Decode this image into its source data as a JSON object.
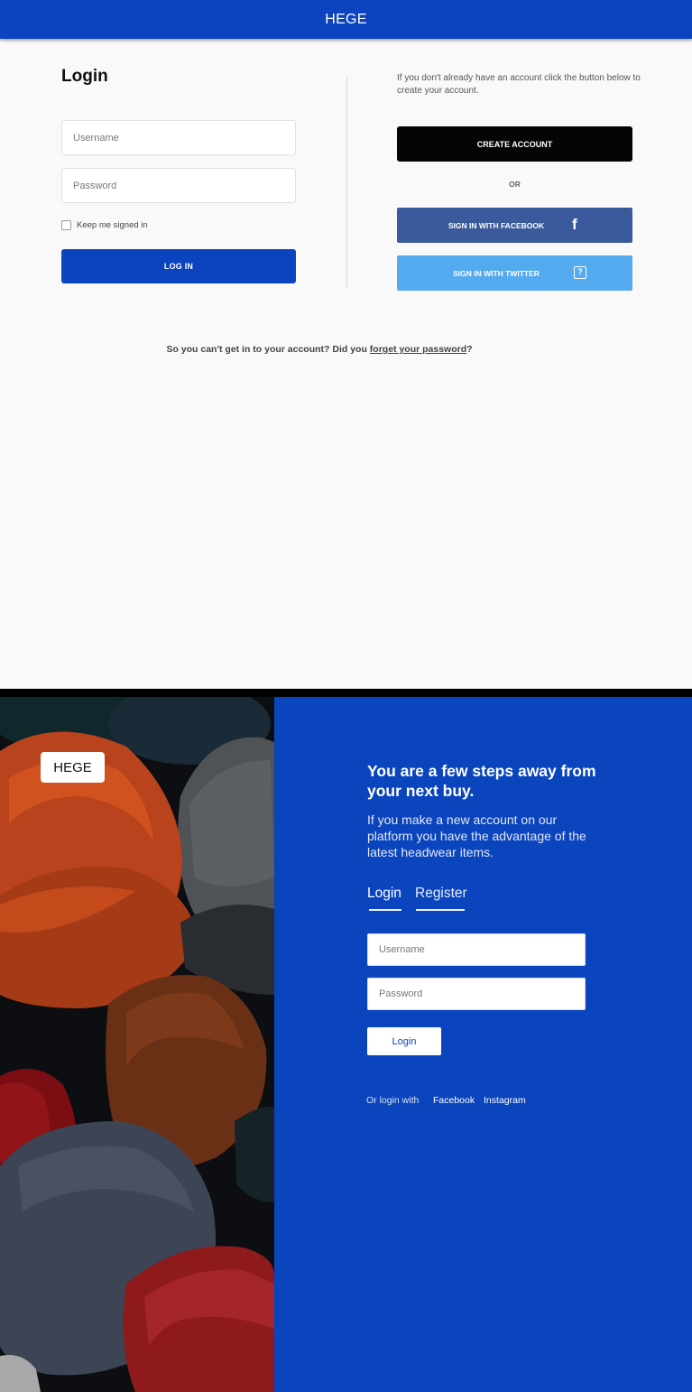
{
  "screen1": {
    "header": {
      "title": "HEGE"
    },
    "login": {
      "heading": "Login",
      "username_placeholder": "Username",
      "password_placeholder": "Password",
      "keep_signed_in_label": "Keep me signed in",
      "login_button": "LOG IN"
    },
    "register": {
      "info_text": "If you don't already have an account click the button below to create your account.",
      "create_account_button": "CREATE ACCOUNT",
      "or_label": "OR",
      "facebook_button": "SIGN IN WITH FACEBOOK",
      "facebook_icon": "facebook-icon",
      "twitter_button": "SIGN IN WITH TWITTER",
      "twitter_icon": "missing-image-icon"
    },
    "forgot": {
      "prefix": "So you can't get in to your account? Did you ",
      "link": "forget your password",
      "suffix": "?"
    }
  },
  "screen2": {
    "logo": "HEGE",
    "headline": "You are a few steps away from your next buy.",
    "subtext": "If you make a new account on our platform you have the advantage of the latest headwear items.",
    "tabs": [
      {
        "label": "Login"
      },
      {
        "label": "Register"
      }
    ],
    "username_placeholder": "Username",
    "password_placeholder": "Password",
    "login_button": "Login",
    "or_login_with": "Or login with",
    "social_links": [
      "Facebook",
      "Instagram"
    ]
  },
  "colors": {
    "brand_blue": "#0c44bf",
    "facebook_blue": "#3a5a9c",
    "twitter_blue": "#54aaee",
    "black_button": "#050505",
    "page_background": "#f9f9f9"
  }
}
